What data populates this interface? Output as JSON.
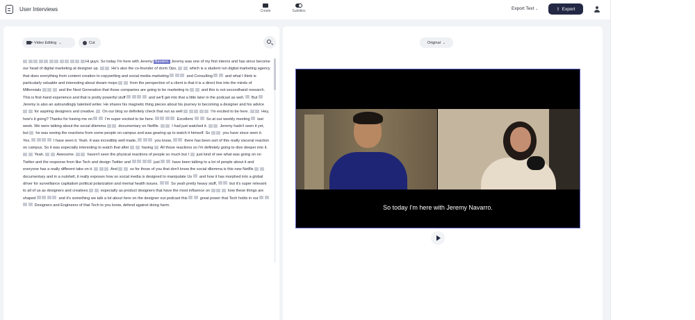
{
  "header": {
    "doc_title": "User Interviews",
    "modes": [
      {
        "label": "Create",
        "icon": "video-camera-icon"
      },
      {
        "label": "Subtitles",
        "icon": "toggle-icon",
        "active": true
      }
    ],
    "export_text_label": "Export Text",
    "export_label": "Export",
    "icons": {
      "logo": "app-logo-icon",
      "avatar": "user-avatar-icon"
    }
  },
  "toolbar": {
    "mode_select_label": "Video Editing",
    "cut_label": "Cut",
    "search_icon": "search-icon"
  },
  "transcript": {
    "segments": [
      {
        "blanks": 12,
        "text": "Hi guys. So today I'm here with Jeremy "
      },
      {
        "highlight": "Navarro."
      },
      {
        "blanks": 0,
        "text": " Jeremy was one of my first interns and has since become our head of digital marketing at designer up. "
      },
      {
        "blanks": 2,
        "text": " He's also the co-founder of dorm Ops, "
      },
      {
        "blanks": 2,
        "text": " which is a student run digital marketing agency that does everything from content creation to copywriting and social media marketing "
      },
      {
        "blanks": 3,
        "text": " and Consulting "
      },
      {
        "blanks": 2,
        "text": " and what I think is particularly valuable and interesting about dream mops "
      },
      {
        "blanks": 2,
        "text": " from "
      },
      {
        "blanks": 0,
        "text": " the perspective of a client is that it is a direct line into the minds of Millennials "
      },
      {
        "blanks": 3,
        "text": " and the Next Generation that those companies are going to be marketing to "
      },
      {
        "blanks": 2,
        "text": " and this is not secondhand research. This is first-hand experience and that is pretty powerful stuff "
      },
      {
        "blanks": 4,
        "text": " and we'll get into that a little later in the podcast as well. "
      },
      {
        "blanks": 1,
        "text": " But "
      },
      {
        "blanks": 1,
        "text": " Jeremy is also an astoundingly talented writer. He shares his magnetic thing pieces about his journey to becoming a designer and his advice "
      },
      {
        "blanks": 2,
        "text": " for aspiring designers and creative. "
      },
      {
        "blanks": 1,
        "text": " On our blog so definitely check that out as well "
      },
      {
        "blanks": 5,
        "text": " I'm excited to be here. "
      },
      {
        "blanks": 2,
        "text": " Hey, how's it going? Thanks for having me on "
      },
      {
        "blanks": 2,
        "text": " I'm super excited to be here. "
      },
      {
        "blanks": 4,
        "text": " Excellent. "
      },
      {
        "blanks": 2,
        "text": " So at our weekly meeting "
      },
      {
        "blanks": 1,
        "text": " last week. We were talking about the social dilemma "
      },
      {
        "blanks": 2,
        "text": " documentary on Netflix. "
      },
      {
        "blanks": 2,
        "text": " I had just watched it. "
      },
      {
        "blanks": 2,
        "text": " Jeremy hadn't seen it yet, but "
      },
      {
        "blanks": 1,
        "text": " he was seeing the reactions from some people on campus and was gearing up to watch it himself. So "
      },
      {
        "blanks": 2,
        "text": " you have since seen it. Yes. "
      },
      {
        "blanks": 4,
        "text": " I have seen it. Yeah. It was incredibly well made, "
      },
      {
        "blanks": 3,
        "text": " you know, "
      },
      {
        "blanks": 2,
        "text": " there has been sort of this really visceral reaction on campus. So it was especially interesting to watch that after "
      },
      {
        "blanks": 2,
        "text": " having "
      },
      {
        "blanks": 1,
        "text": " All those reactions so I'm definitely going to dive deeper into it. "
      },
      {
        "blanks": 2,
        "text": " Yeah. "
      },
      {
        "blanks": 2,
        "text": " Awesome. "
      },
      {
        "blanks": 2,
        "text": " haven't seen the physical reactions of people so much but I "
      },
      {
        "blanks": 1,
        "text": " just kind of see what was going on on Twitter and the response from like Tech and design Twitter and "
      },
      {
        "blanks": 4,
        "text": " just "
      },
      {
        "blanks": 2,
        "text": " have been talking to a lot of people about it and everyone has a really different take on it. "
      },
      {
        "blanks": 3,
        "text": " And "
      },
      {
        "blanks": 2,
        "text": " so for those of you that don't know the social dilemma is this new Netflix "
      },
      {
        "blanks": 2,
        "text": " documentary and in a nutshell, it really exposes how so social media is designed to manipulate Us "
      },
      {
        "blanks": 1,
        "text": " and how it has morphed into a global driver for surveillance capitalism political polarization and mental health issues. "
      },
      {
        "blanks": 2,
        "text": " So yeah pretty heavy stuff, "
      },
      {
        "blanks": 2,
        "text": " but it's super relevant to all of us as designers and creatives "
      },
      {
        "blanks": 2,
        "text": " especially as product designers that have the most influence on "
      },
      {
        "blanks": 3,
        "text": " how these things are shaped "
      },
      {
        "blanks": 4,
        "text": " and it's something we talk a lot about here on the designer out podcast this "
      },
      {
        "blanks": 2,
        "text": " great power that Tech holds in our "
      },
      {
        "blanks": 4,
        "text": " Designers and Engineers of that Tech to you know, defend against doing harm."
      }
    ]
  },
  "preview": {
    "view_select_label": "Original",
    "caption": "So today I'm here with Jeremy  Navarro.",
    "play_icon": "play-icon"
  },
  "colors": {
    "accent": "#232845",
    "highlight": "#6d72c7",
    "video_border": "#5a5fbf",
    "blank_word": "#c7cad2",
    "panel_bg": "#f2f3f6"
  }
}
